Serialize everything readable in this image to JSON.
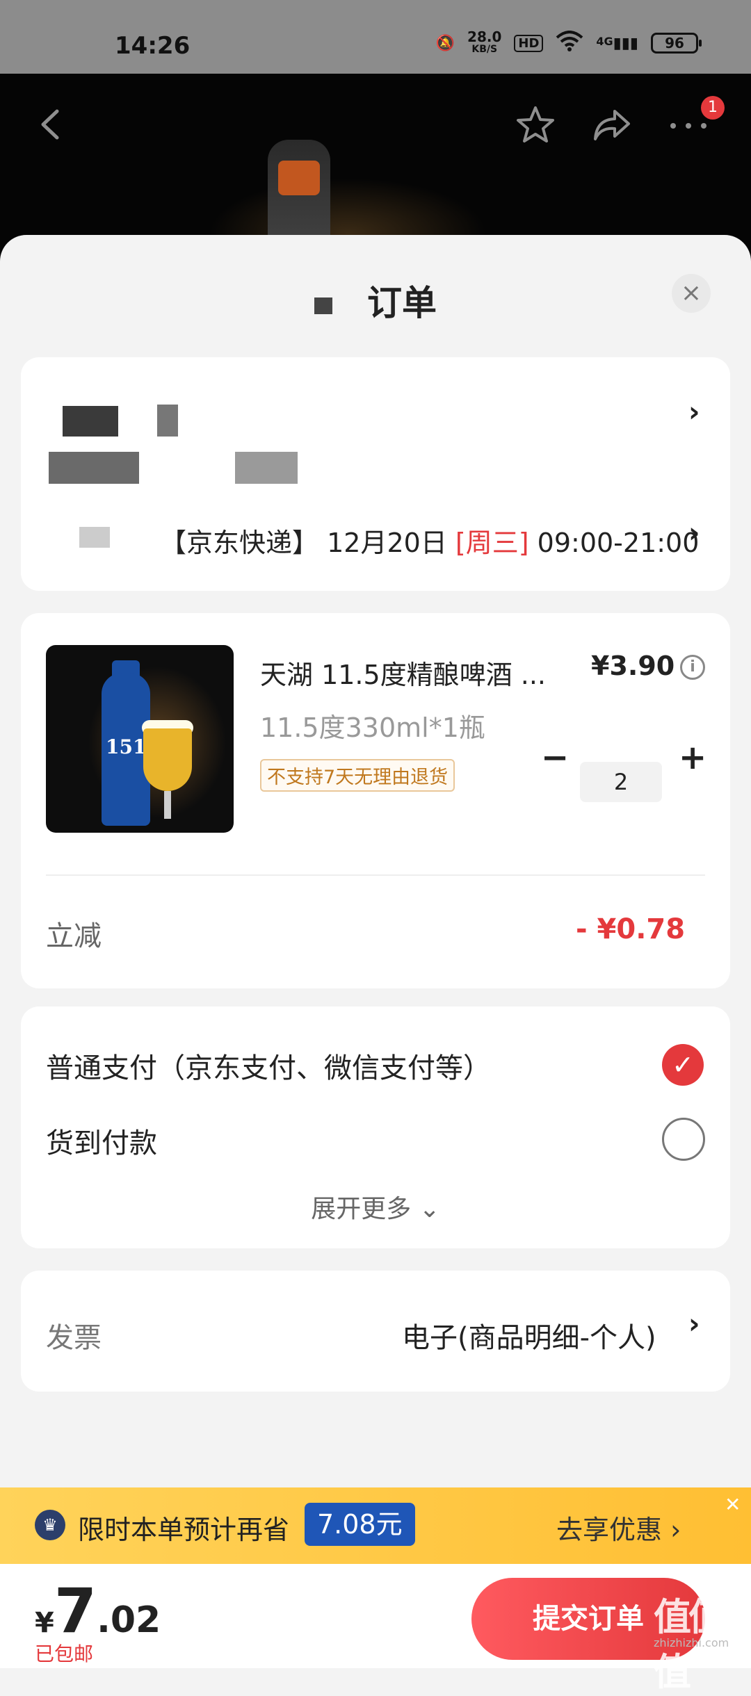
{
  "status_bar": {
    "time": "14:26",
    "net_speed": "28.0",
    "net_unit": "KB/S",
    "hd": "HD",
    "signal": "4G",
    "battery": "96"
  },
  "header": {
    "badge_count": "1"
  },
  "sheet": {
    "title": "订单",
    "close": "×"
  },
  "address": {
    "delivery_carrier": "【京东快递】",
    "delivery_date": "12月20日",
    "delivery_weekday": "[周三]",
    "delivery_window": "09:00-21:00"
  },
  "product": {
    "name": "天湖 11.5度精酿啤酒 ...",
    "spec": "11.5度330ml*1瓶",
    "tag": "不支持7天无理由退货",
    "price": "¥3.90",
    "info_icon": "i",
    "quantity": "2",
    "thumb_label": "1516",
    "discount_label": "立减",
    "discount_value": "- ¥0.78"
  },
  "payment": {
    "option_1": "普通支付（京东支付、微信支付等）",
    "option_2": "货到付款",
    "expand": "展开更多 ⌄"
  },
  "invoice": {
    "label": "发票",
    "value": "电子(商品明细-个人)"
  },
  "promo": {
    "text": "限时本单预计再省",
    "amount": "7.08元",
    "action": "去享优惠 ›"
  },
  "bottom": {
    "currency": "¥",
    "total_int": "7",
    "total_dec": ".02",
    "shipping": "已包邮",
    "submit": "提交订单",
    "watermark": "值值值",
    "watermark_sub": "zhizhizhi.com"
  },
  "colors": {
    "accent": "#e4393c",
    "promo_bg": "#ffc93c",
    "promo_chip": "#1f56b7"
  }
}
